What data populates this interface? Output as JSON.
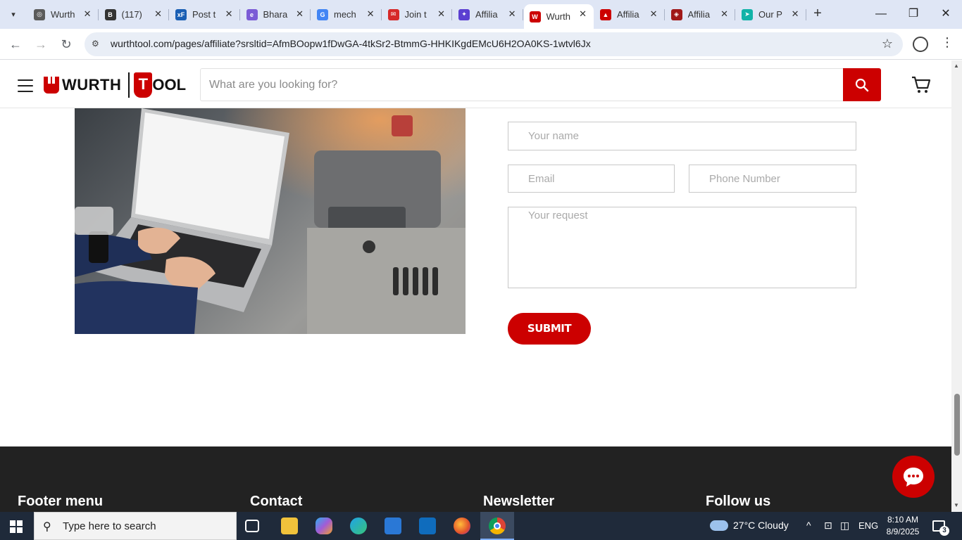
{
  "browser": {
    "tabs": [
      {
        "title": "Wurth",
        "favicon_color": "#5b5b5b",
        "glyph": "◎"
      },
      {
        "title": "(117)",
        "favicon_color": "#333333",
        "glyph": "B"
      },
      {
        "title": "Post t",
        "favicon_color": "#1a5fb4",
        "glyph": "xF"
      },
      {
        "title": "Bhara",
        "favicon_color": "#7b5bd6",
        "glyph": "e"
      },
      {
        "title": "mech",
        "favicon_color": "#4285f4",
        "glyph": "G"
      },
      {
        "title": "Join t",
        "favicon_color": "#d62828",
        "glyph": "✉"
      },
      {
        "title": "Affilia",
        "favicon_color": "#5b3fd1",
        "glyph": "✦"
      },
      {
        "title": "Wurth",
        "favicon_color": "#cc0000",
        "glyph": "W",
        "active": true
      },
      {
        "title": "Affilia",
        "favicon_color": "#cc0000",
        "glyph": "▲"
      },
      {
        "title": "Affilia",
        "favicon_color": "#a01818",
        "glyph": "◈"
      },
      {
        "title": "Our P",
        "favicon_color": "#12b3a8",
        "glyph": "➤"
      }
    ],
    "url": "wurthtool.com/pages/affiliate?srsltid=AfmBOopw1fDwGA-4tkSr2-BtmmG-HHKIKgdEMcU6H2OA0KS-1wtvl6Jx"
  },
  "header": {
    "logo_left": "WURTH",
    "logo_right": "OOL",
    "logo_t": "T",
    "search_placeholder": "What are you looking for?"
  },
  "form": {
    "name_placeholder": "Your name",
    "email_placeholder": "Email",
    "phone_placeholder": "Phone Number",
    "request_placeholder": "Your request",
    "submit_label": "SUBMIT"
  },
  "footer": {
    "col1": "Footer menu",
    "col2": "Contact",
    "col3": "Newsletter",
    "col4": "Follow us"
  },
  "taskbar": {
    "search_text": "Type here to search",
    "weather": "27°C  Cloudy",
    "language": "ENG",
    "time": "8:10 AM",
    "date": "8/9/2025",
    "notifications": "3"
  },
  "colors": {
    "brand_red": "#cc0000",
    "footer_bg": "#222222"
  }
}
